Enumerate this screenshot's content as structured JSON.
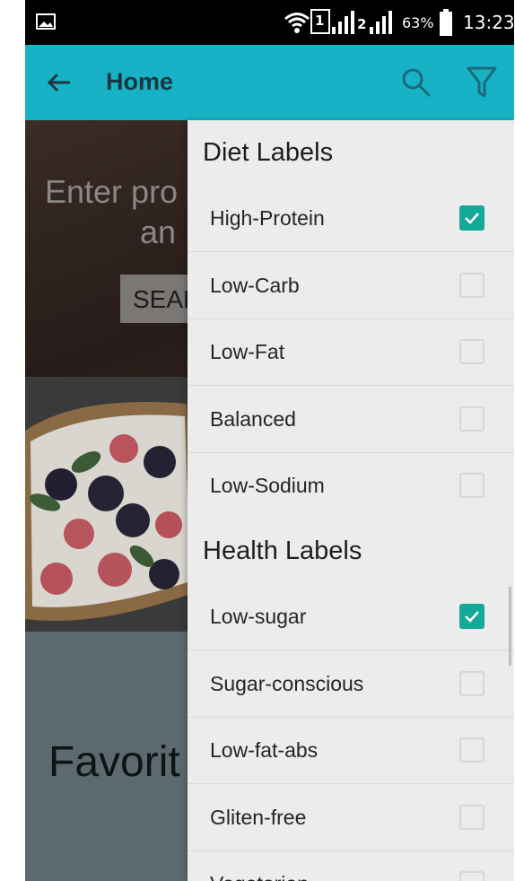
{
  "status_bar": {
    "sim1": "1",
    "sim2": "2",
    "battery": "63%",
    "time": "13:23"
  },
  "app_bar": {
    "title": "Home",
    "back_icon": "arrow-left-icon",
    "search_icon": "search-icon",
    "filter_icon": "filter-icon",
    "color": "#17b2c6"
  },
  "background": {
    "hero_line1": "Enter pro",
    "hero_line2": "an",
    "search_button": "SEAF",
    "favorites_heading": "Favorit"
  },
  "drawer": {
    "diet_title": "Diet Labels",
    "diet_items": [
      {
        "label": "High-Protein",
        "checked": true
      },
      {
        "label": "Low-Carb",
        "checked": false
      },
      {
        "label": "Low-Fat",
        "checked": false
      },
      {
        "label": "Balanced",
        "checked": false
      },
      {
        "label": "Low-Sodium",
        "checked": false
      }
    ],
    "health_title": "Health Labels",
    "health_items": [
      {
        "label": "Low-sugar",
        "checked": true
      },
      {
        "label": "Sugar-conscious",
        "checked": false
      },
      {
        "label": "Low-fat-abs",
        "checked": false
      },
      {
        "label": "Gliten-free",
        "checked": false
      },
      {
        "label": "Vegetarian",
        "checked": false
      }
    ],
    "checkbox_color": "#14a898"
  }
}
